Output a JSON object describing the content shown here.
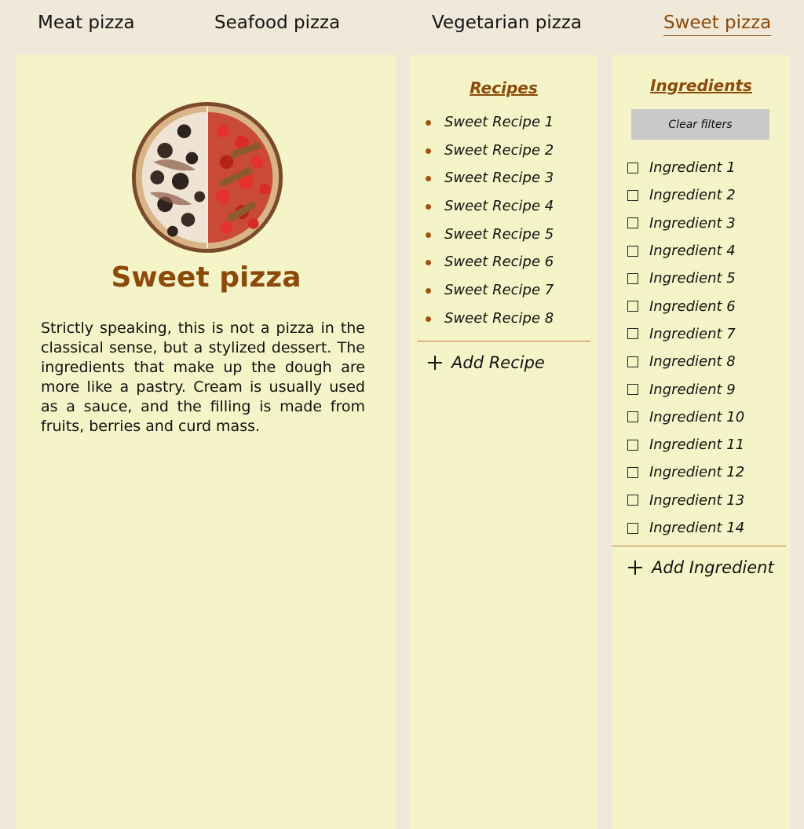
{
  "nav": {
    "tabs": [
      {
        "label": "Meat pizza"
      },
      {
        "label": "Seafood pizza"
      },
      {
        "label": "Vegetarian pizza"
      },
      {
        "label": "Sweet pizza"
      }
    ]
  },
  "main": {
    "title": "Sweet pizza",
    "description": "Strictly speaking, this is not a pizza in the classical sense, but a stylized dessert. The ingredients that make up the dough are more like a pastry. Cream is usually used as a sauce, and the filling is made from fruits, berries and curd mass."
  },
  "recipes": {
    "title": "Recipes",
    "items": [
      {
        "label": "Sweet Recipe 1"
      },
      {
        "label": "Sweet Recipe 2"
      },
      {
        "label": "Sweet Recipe 3"
      },
      {
        "label": "Sweet Recipe 4"
      },
      {
        "label": "Sweet Recipe 5"
      },
      {
        "label": "Sweet Recipe 6"
      },
      {
        "label": "Sweet Recipe 7"
      },
      {
        "label": "Sweet Recipe 8"
      }
    ],
    "add_label": "Add Recipe"
  },
  "ingredients": {
    "title": "Ingredients",
    "clear_label": "Clear filters",
    "items": [
      {
        "label": "Ingredient 1"
      },
      {
        "label": "Ingredient 2"
      },
      {
        "label": "Ingredient 3"
      },
      {
        "label": "Ingredient 4"
      },
      {
        "label": "Ingredient 5"
      },
      {
        "label": "Ingredient 6"
      },
      {
        "label": "Ingredient 7"
      },
      {
        "label": "Ingredient 8"
      },
      {
        "label": "Ingredient 9"
      },
      {
        "label": "Ingredient 10"
      },
      {
        "label": "Ingredient 11"
      },
      {
        "label": "Ingredient 12"
      },
      {
        "label": "Ingredient 13"
      },
      {
        "label": "Ingredient 14"
      }
    ],
    "add_label": "Add Ingredient"
  },
  "colors": {
    "page_background": "#f0e9da",
    "panel_background": "#f5f4c8",
    "accent": "#8b4a0a",
    "button_background": "#c9c9c9"
  }
}
